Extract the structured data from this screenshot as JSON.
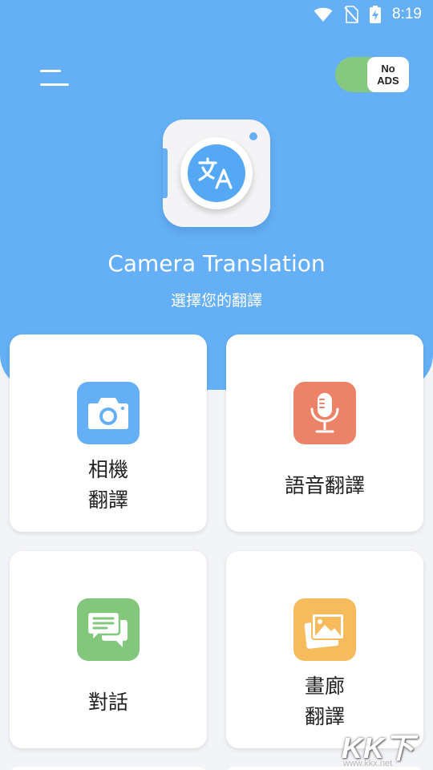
{
  "status_bar": {
    "time": "8:19",
    "icons": [
      "wifi-icon",
      "no-sim-icon",
      "battery-charging-icon"
    ]
  },
  "header": {
    "menu_icon": "hamburger-menu-icon",
    "no_ads": {
      "line1": "No",
      "line2": "ADS",
      "enabled": true
    }
  },
  "app": {
    "logo_icon": "translate-lens-icon",
    "title": "Camera Translation",
    "subtitle": "選擇您的翻譯"
  },
  "cards": [
    {
      "id": "camera",
      "line1": "相機",
      "line2": "翻譯",
      "icon": "camera-icon",
      "color": "#64aff5"
    },
    {
      "id": "voice",
      "line1": "語音翻譯",
      "line2": "",
      "icon": "microphone-icon",
      "color": "#ec8368"
    },
    {
      "id": "chat",
      "line1": "對話",
      "line2": "",
      "icon": "chat-bubbles-icon",
      "color": "#82c77b"
    },
    {
      "id": "gallery",
      "line1": "畫廊",
      "line2": "翻譯",
      "icon": "gallery-images-icon",
      "color": "#f6bb5d"
    }
  ],
  "colors": {
    "primary_blue": "#64aff5",
    "background": "#f3f4f8",
    "toggle_green": "#84c97e"
  },
  "watermark": {
    "logo": "KK下载",
    "url": "www.kkx.net"
  }
}
